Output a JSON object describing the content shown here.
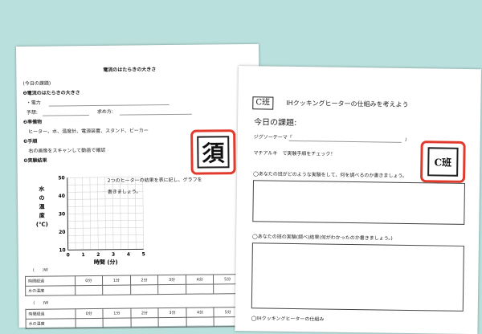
{
  "left_sheet": {
    "title": "電流のはたらきの大きさ",
    "today_theme_label": "(今日の課題)",
    "theme_heading": "❶電流のはたらきの大きさ",
    "power_label": "・電力",
    "estimate_label": "予想:",
    "target_label": "求め方:",
    "materials_heading": "❷準備物",
    "materials_text": "ヒーター、水、温度計、電源装置、スタンド、ビーカー",
    "procedure_heading": "❸手順",
    "procedure_text": "右の画像をスキャンして動画で確認",
    "results_heading": "❹実験結果",
    "chart_note_line1": "2つのヒーターの結果を表に記し、グラフを",
    "chart_note_line2": "書きましょう。",
    "stamp_text": "須",
    "table1_label": "(　　)W",
    "table2_label": "(　　)W",
    "table_header": [
      "時間経過",
      "0分",
      "1分",
      "2分",
      "3分",
      "4分",
      "5分"
    ],
    "table_row_label": "水の温度"
  },
  "chart_data": {
    "type": "line",
    "title": "",
    "xlabel": "時間 (分)",
    "ylabel_chars": [
      "水",
      "の",
      "温",
      "度",
      "(℃)"
    ],
    "x_ticks": [
      "0",
      "1",
      "2",
      "3",
      "4",
      "5"
    ],
    "y_ticks": [
      "10",
      "20",
      "30",
      "40",
      "50"
    ],
    "xlim": [
      0,
      5
    ],
    "ylim": [
      10,
      50
    ],
    "grid": true,
    "series": []
  },
  "right_sheet": {
    "team_badge": "C班",
    "title": "IHクッキングヒーターの仕組みを考えよう",
    "today_theme": "今日の課題:",
    "jigsaw_label": "ジグソーテーマ「",
    "jigsaw_close": "」",
    "machiaruki": "マチアルキ　で実験手順をチェック！",
    "stamp_text": "C班",
    "q1": "◯あなたの班がどのような実験をして、何を調べるのか書きましょう。",
    "q2": "◯あなたの班の実験(調べ)結果(何がわかったのか書きましょう。)",
    "q3": "◯IHクッキングヒーターの仕組み"
  },
  "colors": {
    "background": "#b9e0dc",
    "stamp_border": "#e23b2e"
  }
}
